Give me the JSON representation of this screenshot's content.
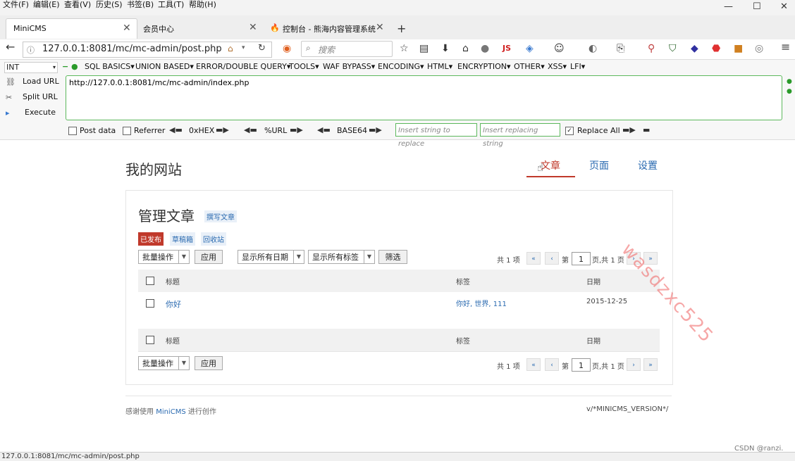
{
  "menubar": {
    "items": [
      "文件(F)",
      "编辑(E)",
      "查看(V)",
      "历史(S)",
      "书签(B)",
      "工具(T)",
      "帮助(H)"
    ],
    "window_controls": [
      "—",
      "☐",
      "✕"
    ]
  },
  "tabs": [
    {
      "label": "MiniCMS",
      "active": true
    },
    {
      "label": "会员中心",
      "active": false
    },
    {
      "label": "控制台 - 熊海内容管理系统",
      "active": false
    }
  ],
  "navbar": {
    "url": "127.0.0.1:8081/mc/mc-admin/post.php",
    "search_placeholder": "搜索",
    "js_label": "JS"
  },
  "hackbar": {
    "select_value": "INT",
    "menus": [
      "SQL BASICS▾",
      "UNION BASED▾",
      "ERROR/DOUBLE QUERY▾",
      "TOOLS▾",
      "WAF BYPASS▾",
      "ENCODING▾",
      "HTML▾",
      "ENCRYPTION▾",
      "OTHER▾",
      "XSS▾",
      "LFI▾"
    ],
    "actions": [
      "Load URL",
      "Split URL",
      "Execute"
    ],
    "url_value": "http://127.0.0.1:8081/mc/mc-admin/index.php",
    "post_data_label": "Post data",
    "referrer_label": "Referrer",
    "hex_label": "0xHEX",
    "url_enc_label": "%URL",
    "base64_label": "BASE64",
    "insert_placeholder": "Insert string to replace",
    "replacing_placeholder": "Insert replacing string",
    "replace_all_label": "Replace All"
  },
  "site": {
    "title": "我的网站",
    "nav": [
      {
        "label": "文章",
        "active": true
      },
      {
        "label": "页面",
        "active": false
      },
      {
        "label": "设置",
        "active": false
      }
    ]
  },
  "manage": {
    "heading": "管理文章",
    "write_link": "撰写文章",
    "filters": [
      {
        "label": "已发布",
        "active": true
      },
      {
        "label": "草稿箱",
        "active": false
      },
      {
        "label": "回收站",
        "active": false
      }
    ],
    "bulk_action": "批量操作",
    "apply": "应用",
    "date_filter": "显示所有日期",
    "tag_filter": "显示所有标签",
    "filter_btn": "筛选",
    "total": "共 1 项",
    "first": "«",
    "prev": "‹",
    "page_prefix": "第",
    "page_value": "1",
    "page_suffix": "页,共 1 页",
    "next": "›",
    "last": "»",
    "columns": [
      "标题",
      "标签",
      "日期"
    ],
    "rows": [
      {
        "title": "你好",
        "tags": "你好, 世界, 111",
        "date": "2015-12-25"
      }
    ]
  },
  "footer": {
    "prefix": "感谢使用",
    "brand": "MiniCMS",
    "suffix": "进行创作",
    "version": "v/*MINICMS_VERSION*/"
  },
  "statusbar": {
    "url": "127.0.0.1:8081/mc/mc-admin/post.php"
  },
  "watermark": "wasdzxc525",
  "csdn": "CSDN @ranzi.",
  "colors": {
    "accent_red": "#c0392b",
    "link_blue": "#2a6ab0",
    "hack_green": "#5cb85c"
  }
}
